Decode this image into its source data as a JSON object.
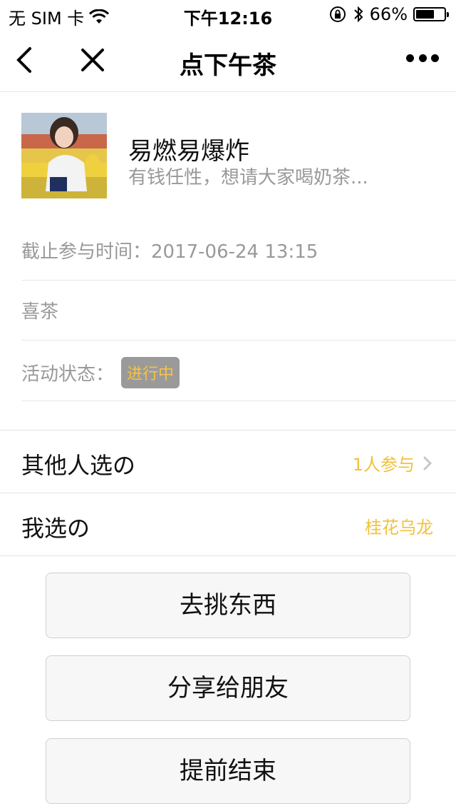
{
  "status_bar": {
    "carrier": "无 SIM 卡",
    "time": "下午12:16",
    "battery": "66%",
    "battery_level": 0.66
  },
  "nav": {
    "title": "点下午茶"
  },
  "profile": {
    "name": "易燃易爆炸",
    "description": "有钱任性，想请大家喝奶茶..."
  },
  "info": {
    "deadline": "截止参与时间：2017-06-24 13:15",
    "shop": "喜茶",
    "status_label": "活动状态：",
    "status_badge": "进行中"
  },
  "list": {
    "others_title": "其他人选の",
    "others_value": "1人参与",
    "mine_title": "我选の",
    "mine_value": "桂花乌龙"
  },
  "buttons": {
    "pick": "去挑东西",
    "share": "分享给朋友",
    "end": "提前结束"
  },
  "colors": {
    "accent": "#f2c13a",
    "badge_bg": "#9a9a9a"
  }
}
